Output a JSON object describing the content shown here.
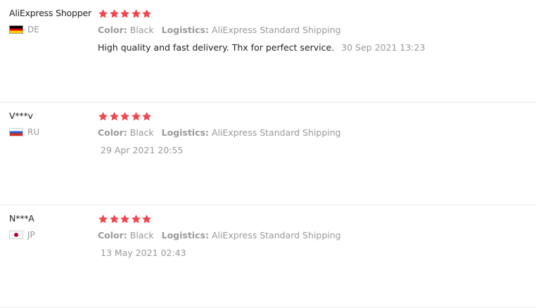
{
  "reviews": [
    {
      "user_name": "AliExpress Shopper",
      "country_code": "DE",
      "flag": "de-flag",
      "rating": 5,
      "color_label": "Color:",
      "color_value": "Black",
      "logistics_label": "Logistics:",
      "logistics_value": "AliExpress Standard Shipping",
      "feedback": "High quality and fast delivery. Thx for perfect service.",
      "time": "30 Sep 2021 13:23"
    },
    {
      "user_name": "V***v",
      "country_code": "RU",
      "flag": "ru-flag",
      "rating": 5,
      "color_label": "Color:",
      "color_value": "Black",
      "logistics_label": "Logistics:",
      "logistics_value": "AliExpress Standard Shipping",
      "feedback": "",
      "time": "29 Apr 2021 20:55"
    },
    {
      "user_name": "N***A",
      "country_code": "JP",
      "flag": "jp-flag",
      "rating": 5,
      "color_label": "Color:",
      "color_value": "Black",
      "logistics_label": "Logistics:",
      "logistics_value": "AliExpress Standard Shipping",
      "feedback": "",
      "time": "13 May 2021 02:43"
    }
  ],
  "colors": {
    "star": "#f0474f",
    "muted_text": "#999999",
    "divider": "#e8e8e8"
  }
}
